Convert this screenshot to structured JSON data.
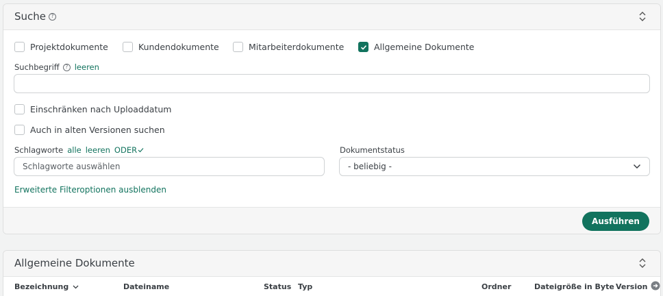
{
  "search": {
    "title": "Suche",
    "help": "?",
    "doc_types": [
      {
        "label": "Projektdokumente",
        "checked": false
      },
      {
        "label": "Kundendokumente",
        "checked": false
      },
      {
        "label": "Mitarbeiterdokumente",
        "checked": false
      },
      {
        "label": "Allgemeine Dokumente",
        "checked": true
      }
    ],
    "term_label": "Suchbegriff",
    "term_clear": "leeren",
    "term_value": "",
    "restrict_upload": "Einschränken nach Uploaddatum",
    "old_versions": "Auch in alten Versionen suchen",
    "tags_label": "Schlagworte",
    "tags_all": "alle",
    "tags_clear": "leeren",
    "tags_mode": "ODER",
    "tags_placeholder": "Schlagworte auswählen",
    "status_label": "Dokumentstatus",
    "status_value": "- beliebig -",
    "filter_toggle": "Erweiterte Filteroptionen ausblenden",
    "run_label": "Ausführen"
  },
  "results": {
    "title": "Allgemeine Dokumente",
    "columns": [
      "Bezeichnung",
      "Dateiname",
      "Status",
      "Typ",
      "Ordner",
      "Dateigröße in Byte",
      "Version"
    ]
  },
  "colors": {
    "accent": "#12735e",
    "border": "#cfd2d4",
    "panel_head": "#f6f6f6"
  }
}
